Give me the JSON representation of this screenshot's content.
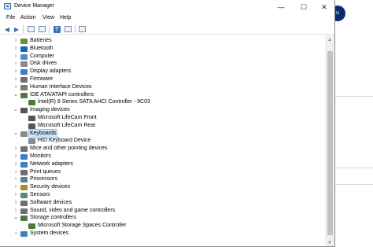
{
  "window": {
    "title": "Device Manager",
    "controls": {
      "minimize": "—",
      "maximize": "☐",
      "close": "✕"
    }
  },
  "menu": {
    "file": "File",
    "action": "Action",
    "view": "View",
    "help": "Help"
  },
  "toolbar": {
    "back": "◀",
    "forward": "▶",
    "help": "?"
  },
  "background_badge": "u",
  "tree": {
    "items": [
      {
        "label": "Batteries",
        "expander": "›",
        "icon": "battery-icon",
        "color": "#6a8f3a"
      },
      {
        "label": "Bluetooth",
        "expander": "›",
        "icon": "bluetooth-icon",
        "color": "#1565c0"
      },
      {
        "label": "Computer",
        "expander": "›",
        "icon": "computer-icon",
        "color": "#4a8fd0"
      },
      {
        "label": "Disk drives",
        "expander": "›",
        "icon": "disk-icon",
        "color": "#8a8a8a"
      },
      {
        "label": "Display adapters",
        "expander": "›",
        "icon": "display-icon",
        "color": "#3f7fbf"
      },
      {
        "label": "Firmware",
        "expander": "›",
        "icon": "firmware-icon",
        "color": "#6f6f6f"
      },
      {
        "label": "Human Interface Devices",
        "expander": "›",
        "icon": "hid-icon",
        "color": "#7a7a7a"
      },
      {
        "label": "IDE ATA/ATAPI controllers",
        "expander": "⌄",
        "icon": "controller-icon",
        "color": "#4f7a3f"
      },
      {
        "label": "Intel(R) 8 Series SATA AHCI Controller - 9C03",
        "expander": "",
        "icon": "controller-icon",
        "color": "#4f7a3f"
      },
      {
        "label": "Imaging devices",
        "expander": "⌄",
        "icon": "camera-icon",
        "color": "#555555"
      },
      {
        "label": "Microsoft LifeCam Front",
        "expander": "",
        "icon": "camera-icon",
        "color": "#555555"
      },
      {
        "label": "Microsoft LifeCam Rear",
        "expander": "",
        "icon": "camera-icon",
        "color": "#555555"
      },
      {
        "label": "Keyboards",
        "expander": "⌄",
        "icon": "keyboard-icon",
        "color": "#8a8a8a"
      },
      {
        "label": "HID Keyboard Device",
        "expander": "",
        "icon": "keyboard-icon",
        "color": "#8a8a8a"
      },
      {
        "label": "Mice and other pointing devices",
        "expander": "›",
        "icon": "mouse-icon",
        "color": "#6f6f6f"
      },
      {
        "label": "Monitors",
        "expander": "›",
        "icon": "monitor-icon",
        "color": "#3f7fbf"
      },
      {
        "label": "Network adapters",
        "expander": "›",
        "icon": "network-icon",
        "color": "#3f7fbf"
      },
      {
        "label": "Print queues",
        "expander": "›",
        "icon": "printer-icon",
        "color": "#6f6f6f"
      },
      {
        "label": "Processors",
        "expander": "›",
        "icon": "processor-icon",
        "color": "#5f7f9f"
      },
      {
        "label": "Security devices",
        "expander": "›",
        "icon": "security-icon",
        "color": "#b08a2a"
      },
      {
        "label": "Sensors",
        "expander": "›",
        "icon": "sensor-icon",
        "color": "#4f8f6f"
      },
      {
        "label": "Software devices",
        "expander": "›",
        "icon": "software-icon",
        "color": "#6f6f6f"
      },
      {
        "label": "Sound, video and game controllers",
        "expander": "›",
        "icon": "sound-icon",
        "color": "#6f6f6f"
      },
      {
        "label": "Storage controllers",
        "expander": "⌄",
        "icon": "storage-icon",
        "color": "#4f7a3f"
      },
      {
        "label": "Microsoft Storage Spaces Controller",
        "expander": "",
        "icon": "storage-icon",
        "color": "#4f7a3f"
      },
      {
        "label": "System devices",
        "expander": "›",
        "icon": "system-icon",
        "color": "#3f7fbf"
      }
    ]
  }
}
